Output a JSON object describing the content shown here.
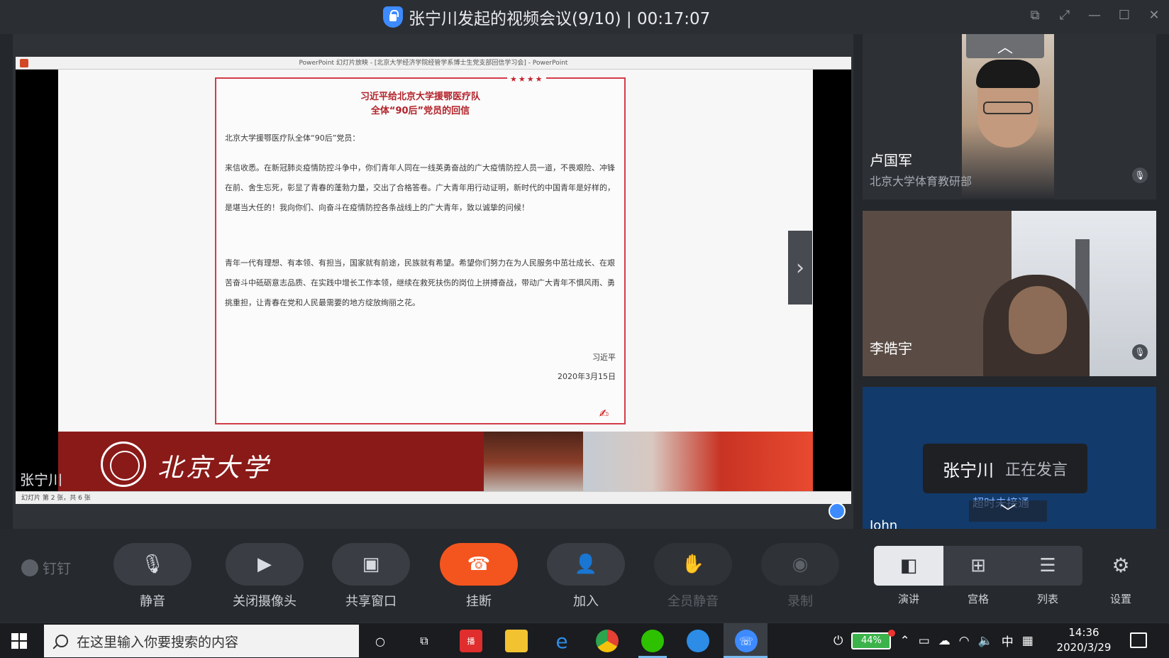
{
  "window": {
    "title": "张宁川发起的视频会议(9/10) | 00:17:07"
  },
  "slideshow": {
    "ppt_title": "PowerPoint 幻灯片放映 - [北京大学经济学院经管学系博士生党支部回信学习会] - PowerPoint",
    "status": "幻灯片 第 2 张，共 6 张",
    "letter": {
      "stars": "★★★★",
      "title_line1": "习近平给北京大学援鄂医疗队",
      "title_line2": "全体“90后”党员的回信",
      "salutation": "北京大学援鄂医疗队全体“90后”党员：",
      "para1": "来信收悉。在新冠肺炎疫情防控斗争中，你们青年人同在一线英勇奋战的广大疫情防控人员一道，不畏艰险、冲锋在前、舍生忘死，彰显了青春的蓬勃力量，交出了合格答卷。广大青年用行动证明，新时代的中国青年是好样的，是堪当大任的！我向你们、向奋斗在疫情防控各条战线上的广大青年，致以诚挚的问候！",
      "para2": "青年一代有理想、有本领、有担当，国家就有前途，民族就有希望。希望你们努力在为人民服务中茁壮成长、在艰苦奋斗中砥砺意志品质、在实践中增长工作本领，继续在救死扶伤的岗位上拼搏奋战，带动广大青年不惧风雨、勇挑重担，让青春在党和人民最需要的地方绽放绚丽之花。",
      "signer": "习近平",
      "date": "2020年3月15日"
    },
    "banner_text": "北京大学",
    "speaker_label": "张宁川"
  },
  "participants": [
    {
      "name": "卢国军",
      "org": "北京大学体育教研部"
    },
    {
      "name": "李皓宇"
    },
    {
      "name": "John",
      "hint": "超时未接通"
    }
  ],
  "speaking": {
    "name": "张宁川",
    "status": "正在发言"
  },
  "controls": {
    "brand": "钉钉",
    "mute": "静音",
    "camera_off": "关闭摄像头",
    "share_window": "共享窗口",
    "hangup": "挂断",
    "join": "加入",
    "mute_all": "全员静音",
    "record": "录制",
    "layout_speaker": "演讲",
    "layout_grid": "宫格",
    "layout_list": "列表",
    "settings": "设置"
  },
  "taskbar": {
    "search_placeholder": "在这里输入你要搜索的内容",
    "battery": "44%",
    "ime": "中",
    "time": "14:36",
    "date": "2020/3/29"
  },
  "colors": {
    "hangup": "#f4551e",
    "accent": "#3d8bff",
    "letter_border": "#d33b4a",
    "banner": "#8a1a18"
  }
}
